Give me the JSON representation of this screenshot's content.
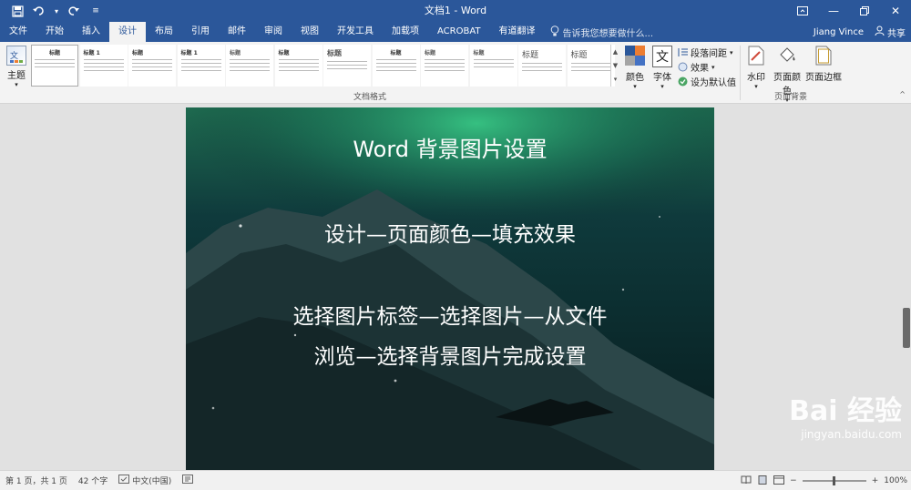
{
  "window": {
    "title": "文档1 - Word"
  },
  "qat": [
    "save-icon",
    "undo-icon",
    "redo-icon",
    "customize-icon"
  ],
  "tabs": [
    "文件",
    "开始",
    "插入",
    "设计",
    "布局",
    "引用",
    "邮件",
    "审阅",
    "视图",
    "开发工具",
    "加载项",
    "ACROBAT",
    "有道翻译"
  ],
  "active_tab": "设计",
  "tell_me": "告诉我您想要做什么...",
  "user": {
    "name": "Jiang Vince",
    "share": "共享"
  },
  "ribbon": {
    "theme_label": "主题",
    "gallery": [
      {
        "title": "标题"
      },
      {
        "title": "标题 1"
      },
      {
        "title": "标题"
      },
      {
        "title": "标题 1"
      },
      {
        "title": "标题"
      },
      {
        "title": "标题"
      },
      {
        "title": "标题"
      },
      {
        "title": "标题"
      },
      {
        "title": "标题"
      },
      {
        "title": "标题"
      },
      {
        "title": "标题"
      },
      {
        "title": "标题"
      }
    ],
    "gallery_group_label": "文档格式",
    "colors_label": "颜色",
    "fonts_label": "字体",
    "paragraph_spacing": "段落间距",
    "effects": "效果",
    "set_default": "设为默认值",
    "watermark_label": "水印",
    "page_color_label": "页面颜色",
    "page_border_label": "页面边框",
    "page_bg_group_label": "页面背景"
  },
  "document": {
    "lines": [
      "Word  背景图片设置",
      "设计—页面颜色—填充效果",
      "选择图片标签—选择图片—从文件",
      "浏览—选择背景图片完成设置"
    ]
  },
  "watermark": {
    "brand": "Bai  经验",
    "url": "jingyan.baidu.com"
  },
  "status": {
    "page": "第 1 页，共 1 页",
    "words": "42 个字",
    "language": "中文(中国)",
    "zoom": "100%"
  }
}
